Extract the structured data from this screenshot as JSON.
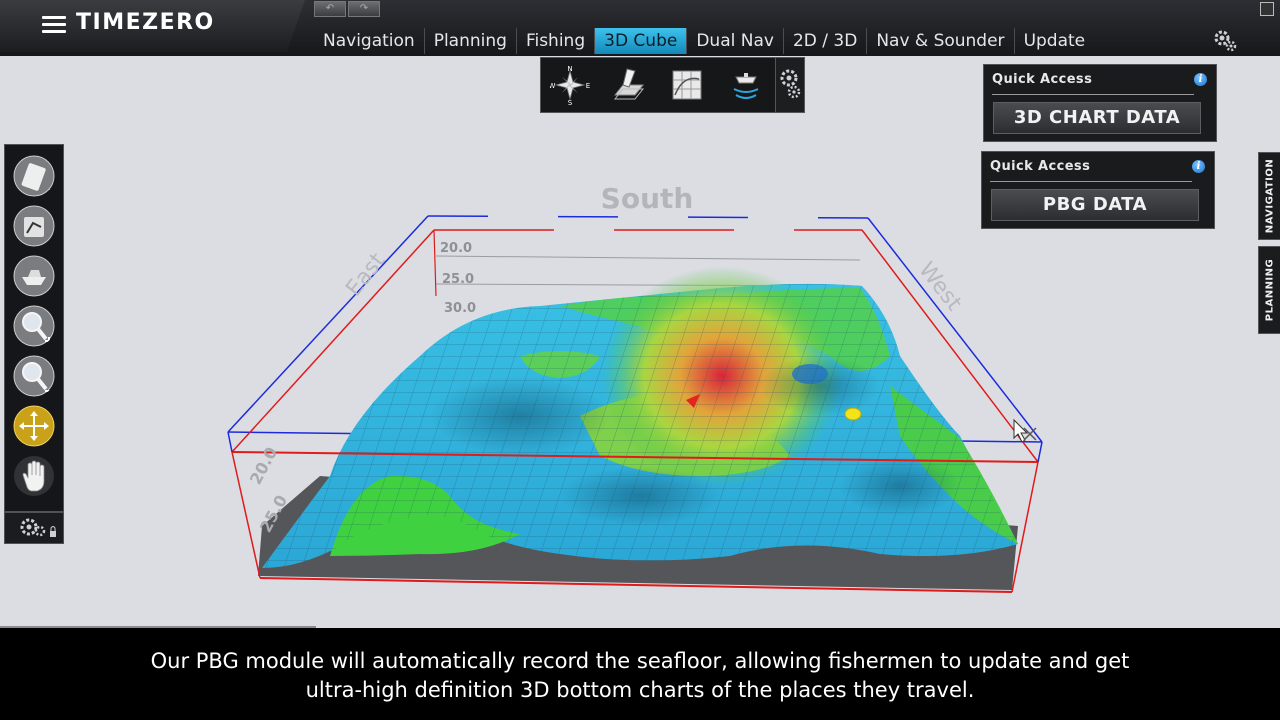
{
  "app": {
    "brand": "TIMEZERO",
    "undo_glyph": "↶",
    "redo_glyph": "↷"
  },
  "tabs": [
    {
      "label": "Navigation",
      "active": false
    },
    {
      "label": "Planning",
      "active": false
    },
    {
      "label": "Fishing",
      "active": false
    },
    {
      "label": "3D Cube",
      "active": true
    },
    {
      "label": "Dual Nav",
      "active": false
    },
    {
      "label": "2D / 3D",
      "active": false
    },
    {
      "label": "Nav & Sounder",
      "active": false
    },
    {
      "label": "Update",
      "active": false
    }
  ],
  "icon_toolbar": {
    "compass_letters": {
      "n": "N",
      "s": "S",
      "e": "E",
      "w": "W"
    },
    "icons": [
      "compass-rose-icon",
      "chart-layers-icon",
      "chart-grid-icon",
      "sounder-icon"
    ]
  },
  "quick_access": [
    {
      "title": "Quick Access",
      "button_label": "3D CHART DATA",
      "info_glyph": "i"
    },
    {
      "title": "Quick Access",
      "button_label": "PBG DATA",
      "info_glyph": "i"
    }
  ],
  "side_tabs": [
    "NAVIGATION",
    "PLANNING"
  ],
  "scene": {
    "face_labels": {
      "south": "South",
      "east": "East",
      "west": "West"
    },
    "depth_labels_back": [
      "20.0",
      "25.0",
      "30.0"
    ],
    "depth_labels_front": [
      "20.0",
      "25.0"
    ],
    "colors": {
      "cube_front": "#e01b1b",
      "cube_back": "#1b2bdc",
      "shallow": "#d62a2a",
      "mid": "#49d64a",
      "deep": "#2fb8e2"
    }
  },
  "left_toolbar": [
    "edit-route-icon",
    "route-tool-icon",
    "boat-icon",
    "zoom-in-icon",
    "zoom-out-icon",
    "pan-tool-icon",
    "hand-icon"
  ],
  "caption": {
    "line1": "Our PBG module will automatically record the seafloor, allowing fishermen to update and get",
    "line2": "ultra-high definition 3D bottom charts of the places they travel."
  }
}
